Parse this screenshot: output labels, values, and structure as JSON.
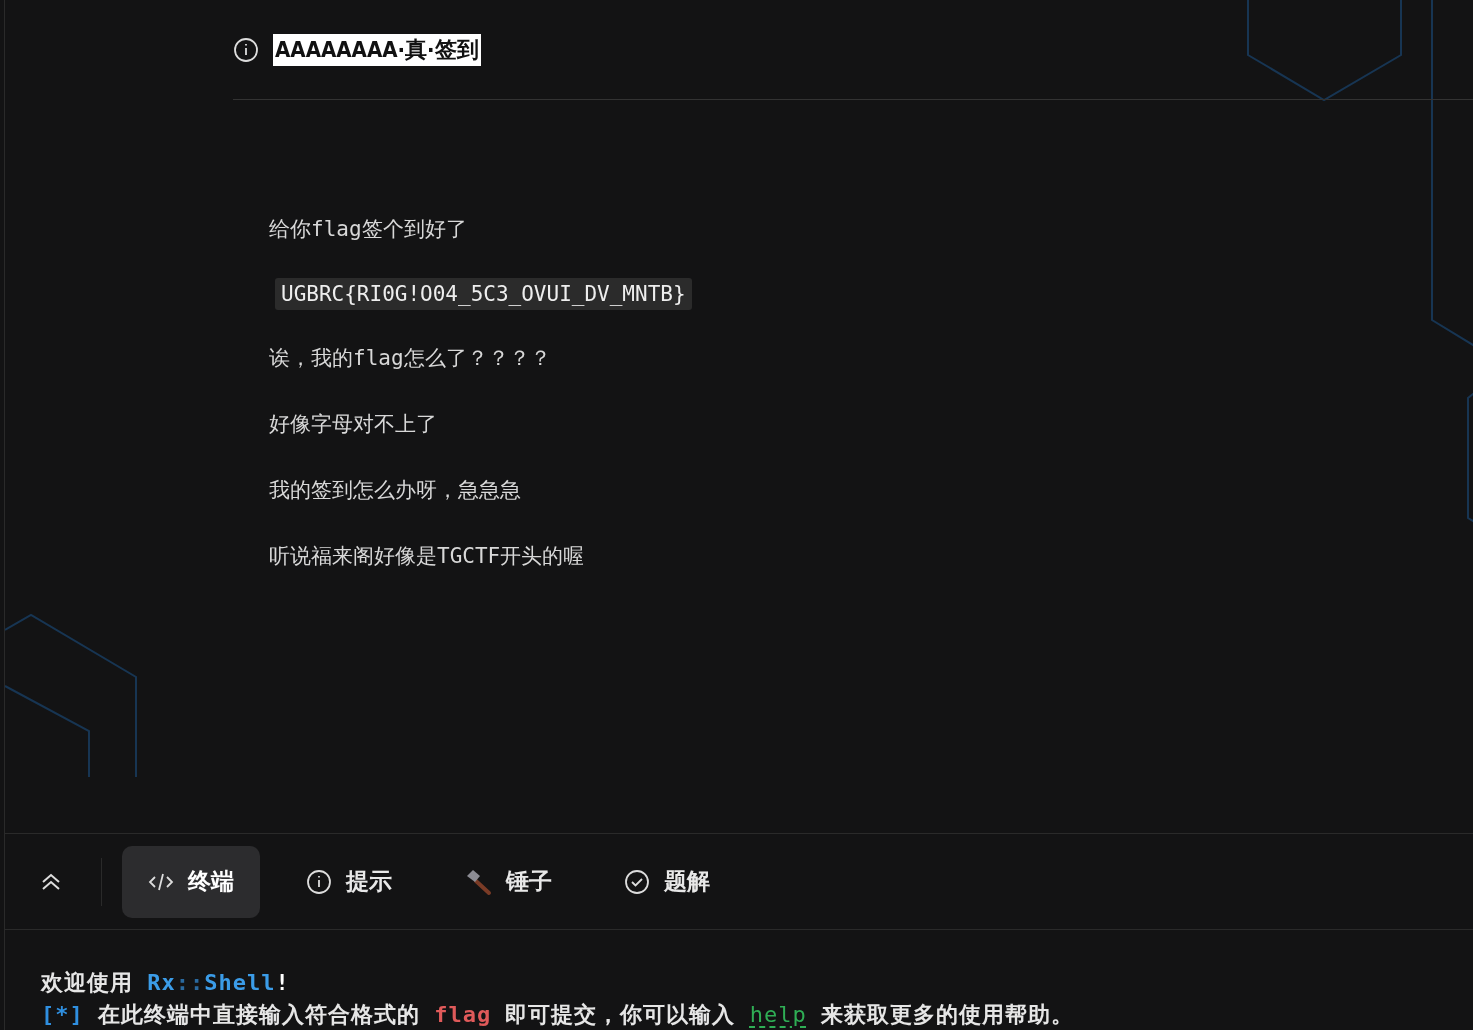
{
  "challenge": {
    "title": "AAAAAAAA·真·签到",
    "paragraphs": [
      {
        "kind": "text",
        "text": "给你flag签个到好了"
      },
      {
        "kind": "code",
        "text": "UGBRC{RI0G!O04_5C3_OVUI_DV_MNTB}"
      },
      {
        "kind": "text",
        "text": "诶，我的flag怎么了？？？？"
      },
      {
        "kind": "text",
        "text": "好像字母对不上了"
      },
      {
        "kind": "text",
        "text": "我的签到怎么办呀，急急急"
      },
      {
        "kind": "text",
        "text": "听说福来阁好像是TGCTF开头的喔"
      }
    ]
  },
  "tabs": [
    {
      "label": "终端",
      "kind": "code",
      "selected": true
    },
    {
      "label": "提示",
      "kind": "info",
      "selected": false
    },
    {
      "label": "锤子",
      "kind": "hammer",
      "selected": false
    },
    {
      "label": "题解",
      "kind": "check",
      "selected": false
    }
  ],
  "terminal": {
    "lines": [
      {
        "segments": [
          {
            "text": "欢迎使用 ",
            "color": "#e6e6e6"
          },
          {
            "text": "Rx",
            "color": "#3b9ce8"
          },
          {
            "text": "::",
            "color": "#2a6aa0"
          },
          {
            "text": "Shell",
            "color": "#3b9ce8"
          },
          {
            "text": "!",
            "color": "#ffffff"
          }
        ]
      },
      {
        "segments": [
          {
            "text": "[*]",
            "color": "#2f8fe0"
          },
          {
            "text": " 在此终端中直接输入符合格式的 ",
            "color": "#e6e6e6"
          },
          {
            "text": "flag",
            "color": "#e05a5a"
          },
          {
            "text": " 即可提交，你可以输入 ",
            "color": "#e6e6e6"
          },
          {
            "text": "help",
            "color": "#2fae55",
            "kind": "link"
          },
          {
            "text": " 来获取更多的使用帮助。",
            "color": "#e6e6e6"
          }
        ]
      }
    ]
  }
}
